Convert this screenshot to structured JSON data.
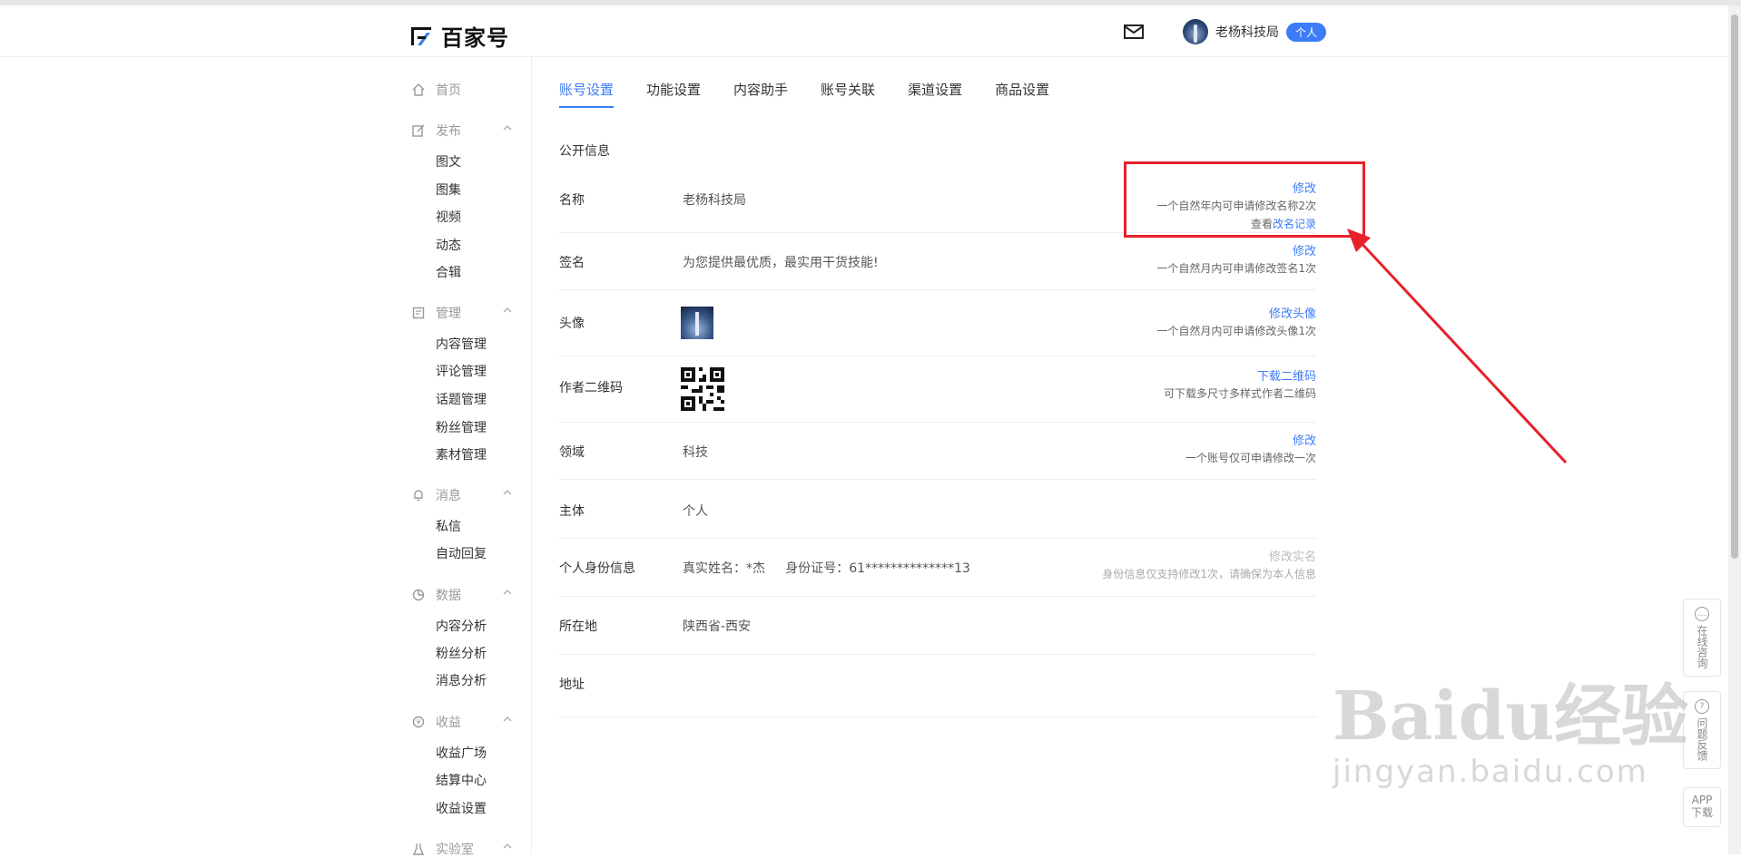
{
  "header": {
    "logo_text": "百家号",
    "username": "老杨科技局",
    "badge": "个人"
  },
  "sidebar": {
    "home": "首页",
    "groups": [
      {
        "title": "发布",
        "icon": "edit-icon",
        "items": [
          "图文",
          "图集",
          "视频",
          "动态",
          "合辑"
        ]
      },
      {
        "title": "管理",
        "icon": "manage-icon",
        "items": [
          "内容管理",
          "评论管理",
          "话题管理",
          "粉丝管理",
          "素材管理"
        ]
      },
      {
        "title": "消息",
        "icon": "bell-icon",
        "items": [
          "私信",
          "自动回复"
        ]
      },
      {
        "title": "数据",
        "icon": "pie-chart-icon",
        "items": [
          "内容分析",
          "粉丝分析",
          "消息分析"
        ]
      },
      {
        "title": "收益",
        "icon": "coin-icon",
        "items": [
          "收益广场",
          "结算中心",
          "收益设置"
        ]
      },
      {
        "title": "实验室",
        "icon": "lab-icon",
        "items": []
      }
    ]
  },
  "tabs": [
    "账号设置",
    "功能设置",
    "内容助手",
    "账号关联",
    "渠道设置",
    "商品设置"
  ],
  "section_title": "公开信息",
  "rows": {
    "name": {
      "label": "名称",
      "value": "老杨科技局",
      "action": "修改",
      "note": "一个自然年内可申请修改名称2次",
      "record_prefix": "查看",
      "record_link": "改名记录"
    },
    "signature": {
      "label": "签名",
      "value": "为您提供最优质，最实用干货技能!",
      "action": "修改",
      "note": "一个自然月内可申请修改签名1次"
    },
    "avatar": {
      "label": "头像",
      "action": "修改头像",
      "note": "一个自然月内可申请修改头像1次"
    },
    "qrcode": {
      "label": "作者二维码",
      "action": "下载二维码",
      "note": "可下载多尺寸多样式作者二维码"
    },
    "field": {
      "label": "领域",
      "value": "科技",
      "action": "修改",
      "note": "一个账号仅可申请修改一次"
    },
    "subject": {
      "label": "主体",
      "value": "个人"
    },
    "identity": {
      "label": "个人身份信息",
      "value": "真实姓名：*杰     身份证号：61**************13",
      "action": "修改实名",
      "note": "身份信息仅支持修改1次，请确保为本人信息"
    },
    "location": {
      "label": "所在地",
      "value": "陕西省-西安"
    },
    "address": {
      "label": "地址"
    }
  },
  "float_panel": {
    "consult": "在线咨询",
    "feedback": "问题反馈",
    "app": "APP下载"
  },
  "watermark": {
    "main": "Baidu经验",
    "sub": "jingyan.baidu.com"
  },
  "colors": {
    "accent": "#3c7cf6",
    "annotation_red": "#e8202a"
  }
}
